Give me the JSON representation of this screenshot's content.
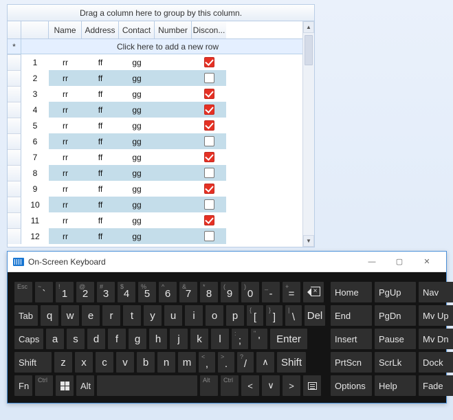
{
  "grid": {
    "group_hint": "Drag a column here to group by this column.",
    "new_row_hint": "Click here to add a new row",
    "new_row_indicator": "*",
    "columns": [
      "Name",
      "Address",
      "Contact",
      "Number",
      "Discon..."
    ],
    "rows": [
      {
        "n": "1",
        "name": "rr",
        "addr": "ff",
        "contact": "gg",
        "number": "",
        "disc": true
      },
      {
        "n": "2",
        "name": "rr",
        "addr": "ff",
        "contact": "gg",
        "number": "",
        "disc": false
      },
      {
        "n": "3",
        "name": "rr",
        "addr": "ff",
        "contact": "gg",
        "number": "",
        "disc": true
      },
      {
        "n": "4",
        "name": "rr",
        "addr": "ff",
        "contact": "gg",
        "number": "",
        "disc": true
      },
      {
        "n": "5",
        "name": "rr",
        "addr": "ff",
        "contact": "gg",
        "number": "",
        "disc": true
      },
      {
        "n": "6",
        "name": "rr",
        "addr": "ff",
        "contact": "gg",
        "number": "",
        "disc": false
      },
      {
        "n": "7",
        "name": "rr",
        "addr": "ff",
        "contact": "gg",
        "number": "",
        "disc": true
      },
      {
        "n": "8",
        "name": "rr",
        "addr": "ff",
        "contact": "gg",
        "number": "",
        "disc": false
      },
      {
        "n": "9",
        "name": "rr",
        "addr": "ff",
        "contact": "gg",
        "number": "",
        "disc": true
      },
      {
        "n": "10",
        "name": "rr",
        "addr": "ff",
        "contact": "gg",
        "number": "",
        "disc": false
      },
      {
        "n": "11",
        "name": "rr",
        "addr": "ff",
        "contact": "gg",
        "number": "",
        "disc": true
      },
      {
        "n": "12",
        "name": "rr",
        "addr": "ff",
        "contact": "gg",
        "number": "",
        "disc": false
      }
    ]
  },
  "osk": {
    "title": "On-Screen Keyboard",
    "row1": [
      {
        "sup": "Esc",
        "sub": ""
      },
      {
        "sup": "~",
        "sub": "`"
      },
      {
        "sup": "!",
        "sub": "1"
      },
      {
        "sup": "@",
        "sub": "2"
      },
      {
        "sup": "#",
        "sub": "3"
      },
      {
        "sup": "$",
        "sub": "4"
      },
      {
        "sup": "%",
        "sub": "5"
      },
      {
        "sup": "^",
        "sub": "6"
      },
      {
        "sup": "&",
        "sub": "7"
      },
      {
        "sup": "*",
        "sub": "8"
      },
      {
        "sup": "(",
        "sub": "9"
      },
      {
        "sup": ")",
        "sub": "0"
      },
      {
        "sup": "_",
        "sub": "-"
      },
      {
        "sup": "+",
        "sub": "="
      },
      {
        "sup": "",
        "sub": "",
        "icon": "bksp"
      }
    ],
    "row2_lead": "Tab",
    "row2": [
      "q",
      "w",
      "e",
      "r",
      "t",
      "y",
      "u",
      "i",
      "o",
      "p"
    ],
    "row2_tail": [
      {
        "sup": "{",
        "sub": "["
      },
      {
        "sup": "}",
        "sub": "]"
      },
      {
        "sup": "|",
        "sub": "\\"
      }
    ],
    "row2_end": "Del",
    "row3_lead": "Caps",
    "row3": [
      "a",
      "s",
      "d",
      "f",
      "g",
      "h",
      "j",
      "k",
      "l"
    ],
    "row3_tail": [
      {
        "sup": ":",
        "sub": ";"
      },
      {
        "sup": "\"",
        "sub": "'"
      }
    ],
    "row3_end": "Enter",
    "row4_lead": "Shift",
    "row4": [
      "z",
      "x",
      "c",
      "v",
      "b",
      "n",
      "m"
    ],
    "row4_tail": [
      {
        "sup": "<",
        "sub": ","
      },
      {
        "sup": ">",
        "sub": "."
      },
      {
        "sup": "?",
        "sub": "/"
      }
    ],
    "row4_up": "∧",
    "row4_end": "Shift",
    "row5": {
      "fn": "Fn",
      "ctrl": "Ctrl",
      "alt": "Alt",
      "altgr": "Alt",
      "ctrlr": "Ctrl",
      "left": "<",
      "down": "∨",
      "right": ">"
    },
    "side": [
      [
        "Home",
        "PgUp",
        "Nav"
      ],
      [
        "End",
        "PgDn",
        "Mv Up"
      ],
      [
        "Insert",
        "Pause",
        "Mv Dn"
      ],
      [
        "PrtScn",
        "ScrLk",
        "Dock"
      ],
      [
        "Options",
        "Help",
        "Fade"
      ]
    ]
  }
}
